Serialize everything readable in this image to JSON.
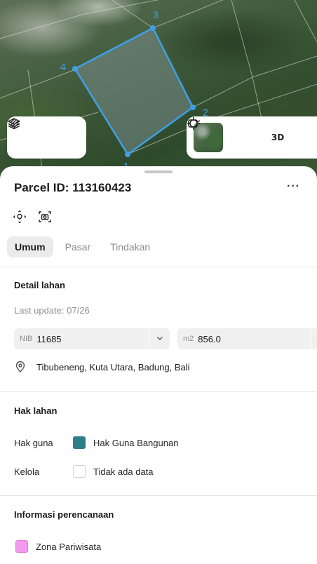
{
  "map": {
    "vertex_labels": [
      "3",
      "4",
      "2",
      "1"
    ],
    "tools_left": {
      "layers_icon": "layers-icon",
      "draw_icon": "draw-icon"
    },
    "tools_right": {
      "locate_icon": "crosshair-icon",
      "btn_3d_label": "3D",
      "capture_icon": "capture-icon"
    }
  },
  "sheet": {
    "title": "Parcel ID: 113160423",
    "more_label": "···",
    "tabs": [
      {
        "label": "Umum",
        "active": true
      },
      {
        "label": "Pasar",
        "active": false
      },
      {
        "label": "Tindakan",
        "active": false
      }
    ],
    "detail": {
      "title": "Detail lahan",
      "last_update": "Last update: 07/26",
      "nib_label": "NIB",
      "nib_value": "11685",
      "area_label": "m2",
      "area_value": "856.0",
      "address": "Tibubeneng, Kuta Utara, Badung, Bali"
    },
    "rights": {
      "title": "Hak lahan",
      "hak_guna_label": "Hak guna",
      "hak_guna_value": "Hak Guna Bangunan",
      "hak_guna_color": "#2e7d89",
      "kelola_label": "Kelola",
      "kelola_value": "Tidak ada data"
    },
    "planning": {
      "title": "Informasi perencanaan",
      "zone_label": "Zona Pariwisata",
      "zone_color": "#f39af0"
    }
  }
}
